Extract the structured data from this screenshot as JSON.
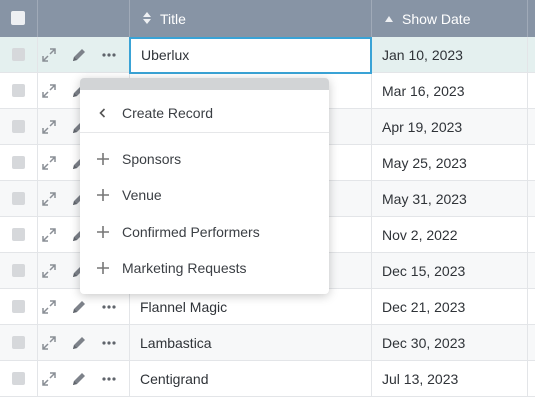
{
  "header": {
    "title_label": "Title",
    "show_date_label": "Show Date"
  },
  "editing": {
    "value": "Uberlux"
  },
  "rows": [
    {
      "title": "Uberlux",
      "date": "Jan 10, 2023"
    },
    {
      "title": "",
      "date": "Mar 16, 2023"
    },
    {
      "title": "",
      "date": "Apr 19, 2023"
    },
    {
      "title": "",
      "date": "May 25, 2023"
    },
    {
      "title": "",
      "date": "May 31, 2023"
    },
    {
      "title": "",
      "date": "Nov 2, 2022"
    },
    {
      "title": "",
      "date": "Dec 15, 2023"
    },
    {
      "title": "Flannel Magic",
      "date": "Dec 21, 2023"
    },
    {
      "title": "Lambastica",
      "date": "Dec 30, 2023"
    },
    {
      "title": "Centigrand",
      "date": "Jul 13, 2023"
    }
  ],
  "menu": {
    "back_label": "Create Record",
    "items": [
      {
        "label": "Sponsors"
      },
      {
        "label": "Venue"
      },
      {
        "label": "Confirmed Performers"
      },
      {
        "label": "Marketing Requests"
      }
    ]
  },
  "icons": {
    "header_checkbox": "checkbox-icon",
    "title_sort": "sort-icon",
    "date_sort": "sort-ascending-icon",
    "row_expand": "expand-icon",
    "row_edit": "pencil-icon",
    "row_more": "ellipsis-icon",
    "menu_back": "chevron-left-icon",
    "menu_add": "plus-icon"
  },
  "colors": {
    "header_bg": "#8794a5",
    "selected_row_bg": "#e4f0ef",
    "edit_border": "#3aa3d6"
  }
}
